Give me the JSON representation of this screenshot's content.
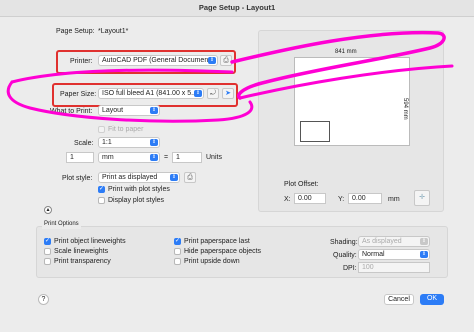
{
  "window": {
    "title": "Page Setup - Layout1"
  },
  "page_setup": {
    "label": "Page Setup:",
    "value": "*Layout1*"
  },
  "printer": {
    "label": "Printer:",
    "value": "AutoCAD PDF (General Document..."
  },
  "paper_size": {
    "label": "Paper Size:",
    "value": "ISO full bleed A1 (841.00 x 5..."
  },
  "what_to_print": {
    "label": "What to Print:",
    "value": "Layout"
  },
  "fit_to_paper": {
    "label": "Fit to paper",
    "checked": false
  },
  "scale": {
    "label": "Scale:",
    "value": "1:1",
    "left": "1",
    "unit": "mm",
    "equals": "=",
    "right": "1",
    "units_label": "Units"
  },
  "plot_style": {
    "label": "Plot style:",
    "value": "Print as displayed"
  },
  "print_with_plot_styles": {
    "label": "Print with plot styles",
    "checked": true
  },
  "display_plot_styles": {
    "label": "Display plot styles",
    "checked": false
  },
  "preview": {
    "width_label": "841 mm",
    "height_label": "594 mm"
  },
  "plot_offset": {
    "label": "Plot Offset:",
    "x_label": "X:",
    "x_value": "0.00",
    "y_label": "Y:",
    "y_value": "0.00",
    "unit": "mm"
  },
  "print_options": {
    "title": "Print Options",
    "col1": [
      {
        "label": "Print object lineweights",
        "checked": true
      },
      {
        "label": "Scale lineweights",
        "checked": false
      },
      {
        "label": "Print transparency",
        "checked": false
      }
    ],
    "col2": [
      {
        "label": "Print paperspace last",
        "checked": true
      },
      {
        "label": "Hide paperspace objects",
        "checked": false
      },
      {
        "label": "Print upside down",
        "checked": false
      }
    ],
    "shading": {
      "label": "Shading:",
      "value": "As displayed"
    },
    "quality": {
      "label": "Quality:",
      "value": "Normal"
    },
    "dpi": {
      "label": "DPI:",
      "value": "100"
    }
  },
  "buttons": {
    "cancel": "Cancel",
    "ok": "OK",
    "help": "?"
  },
  "colors": {
    "accent": "#2c7cf6",
    "highlight_box": "#e0312f",
    "annotation": "#ff00d4"
  }
}
